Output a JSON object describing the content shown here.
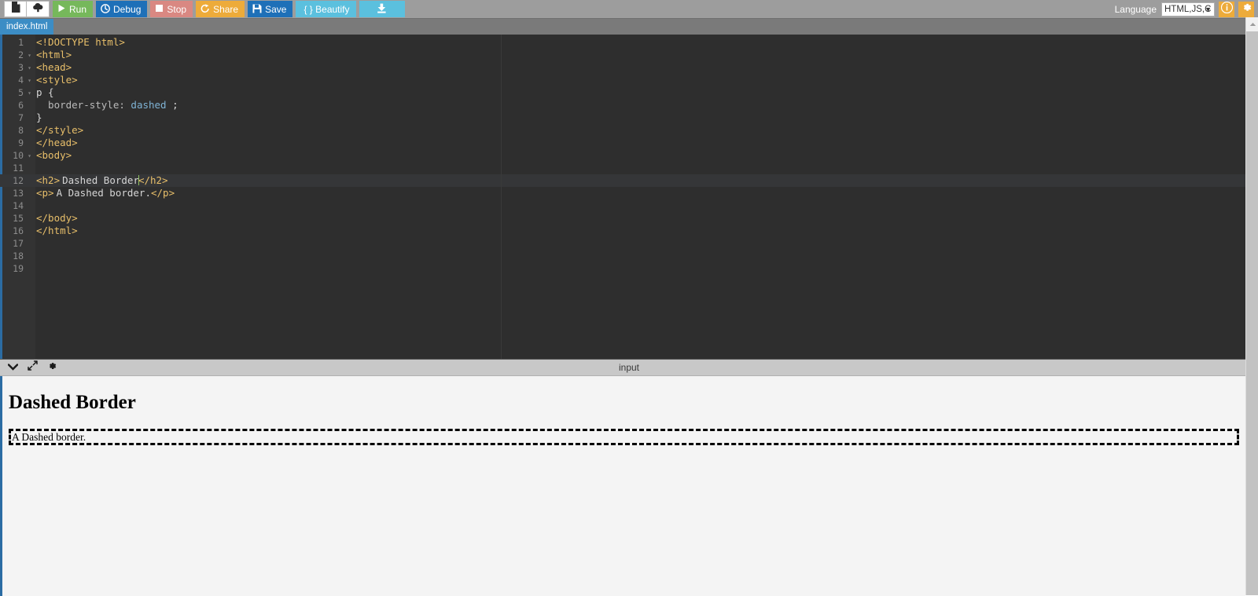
{
  "toolbar": {
    "icon_buttons": [
      {
        "name": "new-file-icon",
        "title": "New File"
      },
      {
        "name": "upload-icon",
        "title": "Upload"
      }
    ],
    "buttons": [
      {
        "name": "run-button",
        "label": "Run",
        "icon": "play-icon",
        "color": "#76b85b"
      },
      {
        "name": "debug-button",
        "label": "Debug",
        "icon": "debug-icon",
        "color": "#1e70b8"
      },
      {
        "name": "stop-button",
        "label": "Stop",
        "icon": "stop-icon",
        "color": "#d98882"
      },
      {
        "name": "share-button",
        "label": "Share",
        "icon": "share-icon",
        "color": "#edab3a"
      },
      {
        "name": "save-button",
        "label": "Save",
        "icon": "floppy-icon",
        "color": "#1e70b8"
      },
      {
        "name": "beautify-button",
        "label": "{ } Beautify",
        "icon": "",
        "color": "#5bc0de"
      }
    ],
    "download_button": {
      "label": "",
      "icon": "download-icon",
      "color": "#5bc0de"
    },
    "language_label": "Language",
    "language_value": "HTML,JS,C",
    "info_button": "i",
    "settings_button": "gear-icon"
  },
  "tabs": [
    {
      "label": "index.html",
      "active": true
    }
  ],
  "editor": {
    "lines": [
      {
        "n": "1",
        "fold": "",
        "html": "<span class=\"tag\">&lt;!DOCTYPE html&gt;</span>"
      },
      {
        "n": "2",
        "fold": "▾",
        "html": "<span class=\"tag\">&lt;html&gt;</span>"
      },
      {
        "n": "3",
        "fold": "▾",
        "html": "<span class=\"tag\">&lt;head&gt;</span>"
      },
      {
        "n": "4",
        "fold": "▾",
        "html": "<span class=\"tag\">&lt;style&gt;</span>"
      },
      {
        "n": "5",
        "fold": "▾",
        "html": "<span class=\"sel\">p {</span>"
      },
      {
        "n": "6",
        "fold": "",
        "html": "<span class=\"prop\">  border-style:</span> <span class=\"val\">dashed</span> <span class=\"punc\">;</span>"
      },
      {
        "n": "7",
        "fold": "",
        "html": "<span class=\"sel\">}</span>"
      },
      {
        "n": "8",
        "fold": "",
        "html": "<span class=\"tag\">&lt;/style&gt;</span>"
      },
      {
        "n": "9",
        "fold": "",
        "html": "<span class=\"tag\">&lt;/head&gt;</span>"
      },
      {
        "n": "10",
        "fold": "▾",
        "html": "<span class=\"tag\">&lt;body&gt;</span>"
      },
      {
        "n": "11",
        "fold": "",
        "html": ""
      },
      {
        "n": "12",
        "fold": "",
        "html": "<span class=\"tag\">&lt;h2&gt;</span><span class=\"code\">Dashed Border</span><span class=\"caret-bar\"></span><span class=\"tag\">&lt;/h2&gt;</span>",
        "active": true
      },
      {
        "n": "13",
        "fold": "",
        "html": "<span class=\"tag\">&lt;p&gt;</span><span class=\"code\">A Dashed border.</span><span class=\"tag\">&lt;/p&gt;</span>"
      },
      {
        "n": "14",
        "fold": "",
        "html": ""
      },
      {
        "n": "15",
        "fold": "",
        "html": "<span class=\"tag\">&lt;/body&gt;</span>"
      },
      {
        "n": "16",
        "fold": "",
        "html": "<span class=\"tag\">&lt;/html&gt;</span>"
      },
      {
        "n": "17",
        "fold": "",
        "html": ""
      },
      {
        "n": "18",
        "fold": "",
        "html": ""
      },
      {
        "n": "19",
        "fold": "",
        "html": ""
      }
    ]
  },
  "output": {
    "title": "input",
    "controls": [
      {
        "name": "collapse-chevron-down-icon"
      },
      {
        "name": "expand-arrows-icon"
      },
      {
        "name": "gear-icon"
      }
    ],
    "preview": {
      "heading": "Dashed Border",
      "paragraph": "A Dashed border."
    }
  },
  "colors": {
    "toolbar_bg": "#9d9d9d",
    "tab_active": "#3c8dc5",
    "editor_bg": "#2e2e2e",
    "gutter_bg": "#333333",
    "accent": "#2b6ca3",
    "output_header_bg": "#c8c8c8",
    "preview_bg": "#f4f4f4"
  }
}
